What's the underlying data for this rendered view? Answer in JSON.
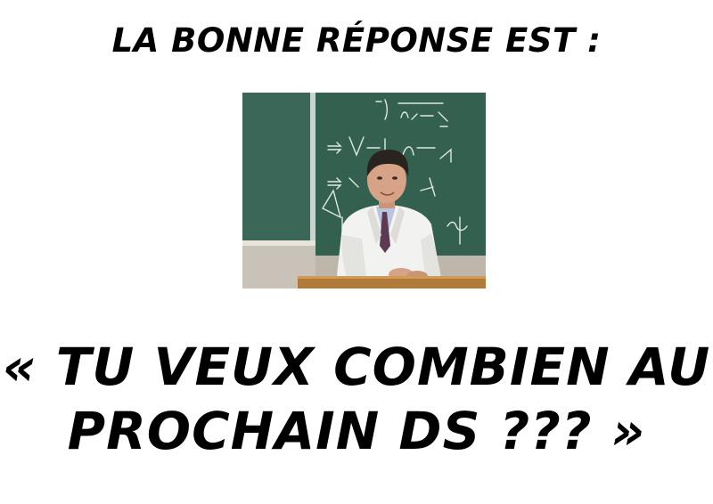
{
  "slide": {
    "heading": "LA BONNE RÉPONSE EST :",
    "quote_line_1": "« TU VEUX COMBIEN AU",
    "quote_line_2": "PROCHAIN DS ??? »"
  },
  "photo": {
    "subject": "teacher-at-blackboard",
    "board_color": "#2f5c4e",
    "coat_color": "#f2f2f0",
    "desk_color": "#b07a3a"
  }
}
